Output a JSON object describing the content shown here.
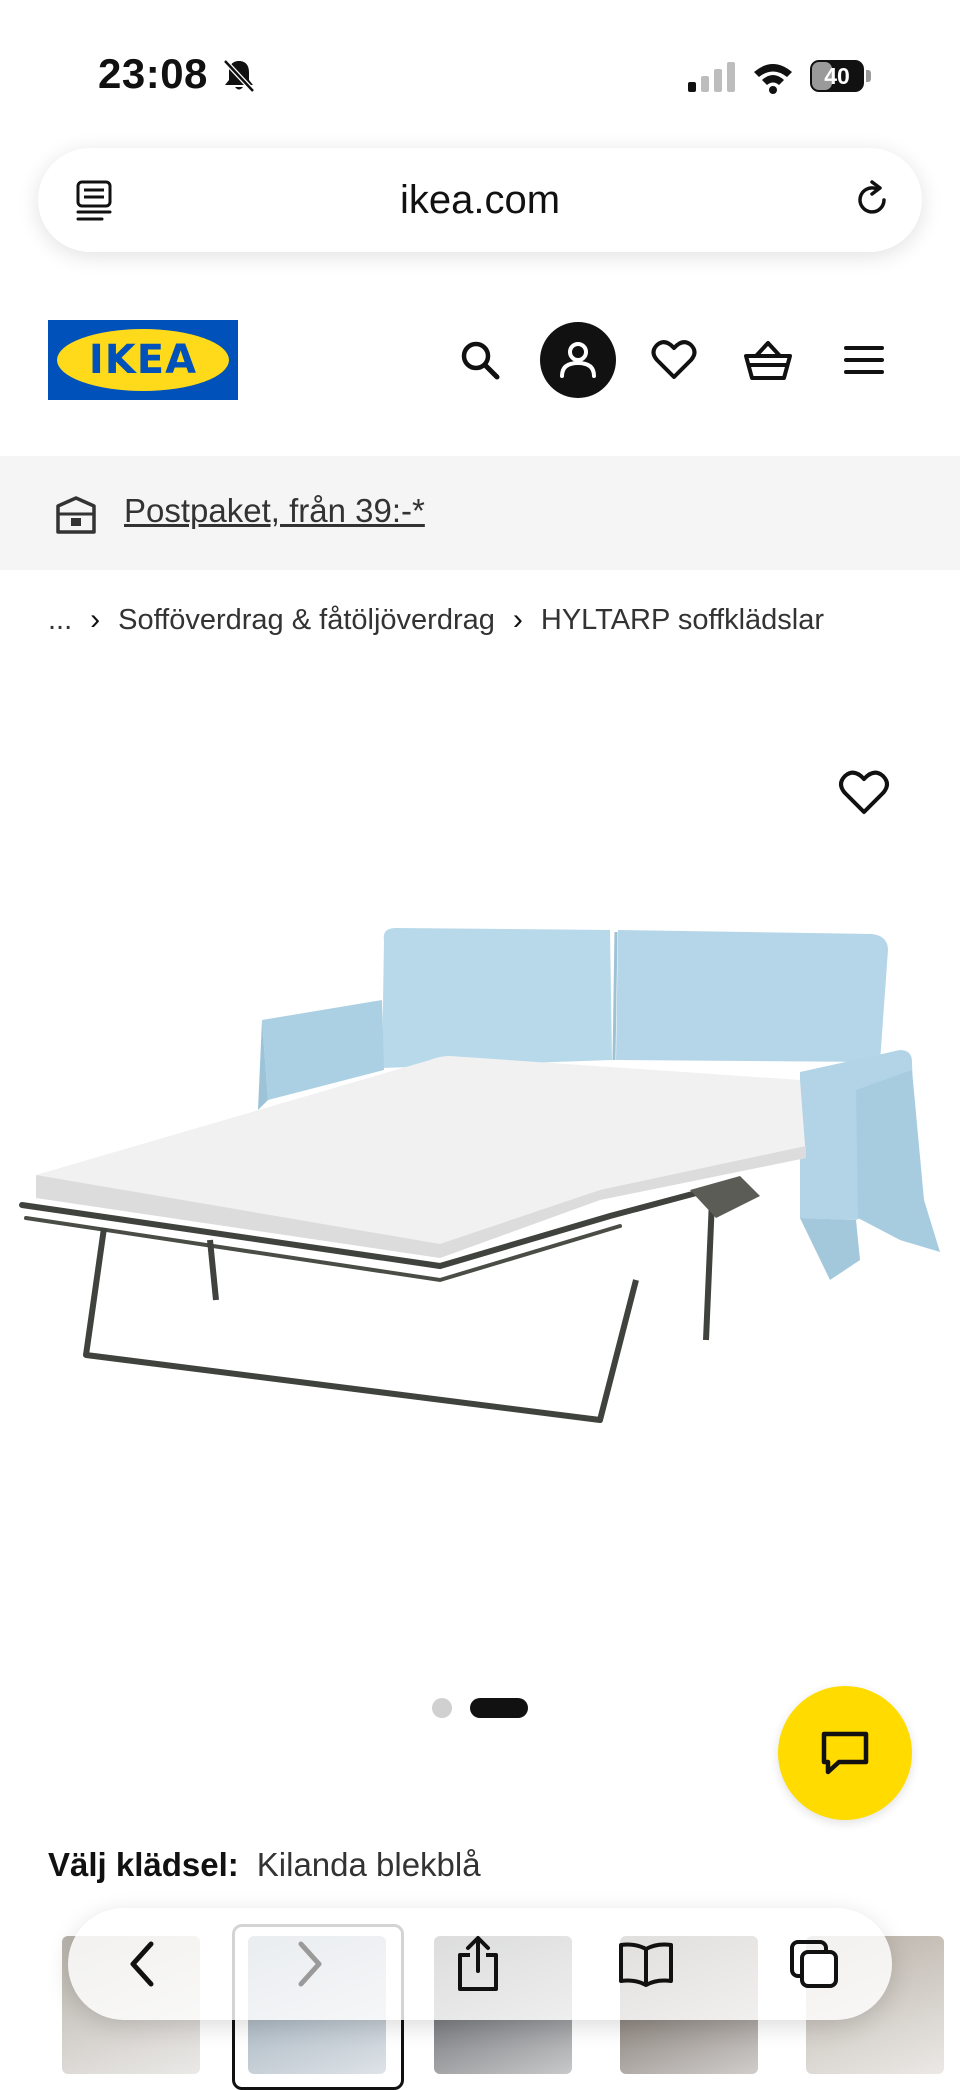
{
  "status_bar": {
    "time": "23:08",
    "battery": "40",
    "battery_level": 0.4,
    "icons": [
      "bell-slash-icon",
      "cellular-signal-icon",
      "wifi-icon",
      "battery-icon"
    ]
  },
  "browser": {
    "url": "ikea.com",
    "tabs_icon": "tab-overview-icon",
    "reload_icon": "reload-icon"
  },
  "header": {
    "logo_text": "IKEA",
    "icons": [
      "search-icon",
      "profile-icon",
      "heart-icon",
      "cart-icon",
      "menu-icon"
    ]
  },
  "promo": {
    "text": "Postpaket, från 39:-*",
    "icon": "package-icon"
  },
  "breadcrumb": {
    "items": [
      "...",
      "Sofföverdrag & fåtöljöverdrag",
      "HYLTARP soffklädslar"
    ],
    "separator": "›"
  },
  "gallery": {
    "image_count": 2,
    "active_index": 1
  },
  "upholstery": {
    "label": "Välj klädsel:",
    "value": "Kilanda blekblå"
  },
  "swatches": {
    "colors": [
      "#b7b2aa",
      "#8a9cab",
      "#3f4146",
      "#5b5048",
      "#b9b1a7"
    ],
    "selected_index": 1
  },
  "colors": {
    "ikea_blue": "#0051ba",
    "ikea_yellow": "#ffda1a",
    "chat_yellow": "#ffdb00",
    "sofa_blue": "#b8d9ea"
  },
  "toolbar": {
    "icons": [
      "back-icon",
      "forward-icon",
      "share-icon",
      "bookmarks-icon",
      "tabs-icon"
    ]
  }
}
